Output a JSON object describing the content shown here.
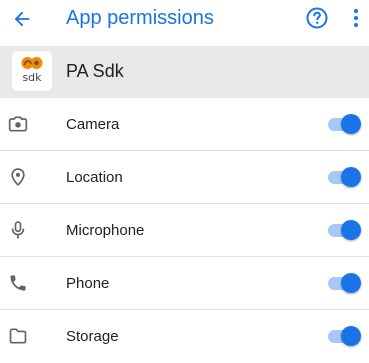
{
  "appbar": {
    "title": "App permissions",
    "back_icon": "arrow-back-icon",
    "help_icon": "help-circle-icon",
    "more_icon": "more-vert-icon"
  },
  "app": {
    "name": "PA Sdk",
    "icon_text": "sdk",
    "icon": "pa-sdk-logo"
  },
  "permissions": [
    {
      "label": "Camera",
      "icon": "camera-icon",
      "enabled": true
    },
    {
      "label": "Location",
      "icon": "location-pin-icon",
      "enabled": true
    },
    {
      "label": "Microphone",
      "icon": "microphone-icon",
      "enabled": true
    },
    {
      "label": "Phone",
      "icon": "phone-icon",
      "enabled": true
    },
    {
      "label": "Storage",
      "icon": "folder-icon",
      "enabled": true
    }
  ],
  "colors": {
    "accent": "#1a73e8",
    "header_bg": "#e8e8e8",
    "switch_track": "#a6c8f7",
    "icon_gray": "#5f6368",
    "logo_orange": "#f28b00"
  }
}
